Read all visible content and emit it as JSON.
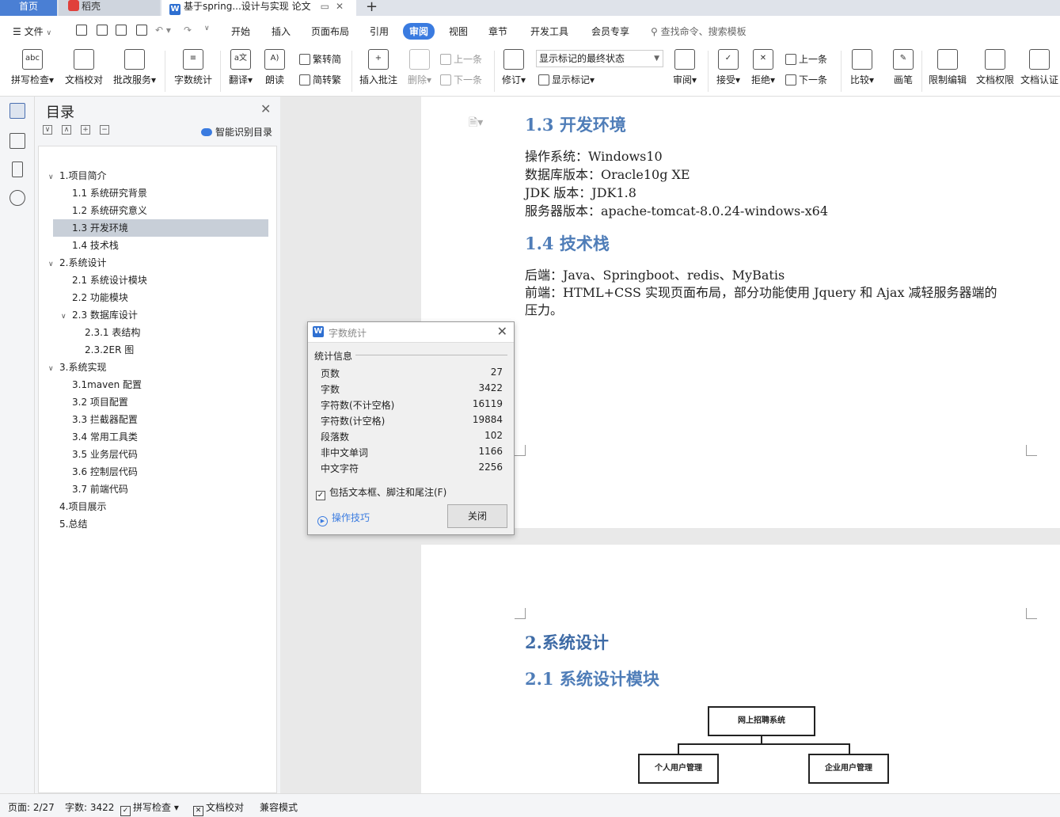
{
  "tabs": {
    "home": "首页",
    "daoke": "稻壳",
    "doc": "基于spring...设计与实现 论文"
  },
  "menu": {
    "file": "文件",
    "items": [
      "开始",
      "插入",
      "页面布局",
      "引用",
      "审阅",
      "视图",
      "章节",
      "开发工具",
      "会员专享"
    ],
    "search": "查找命令、搜索模板"
  },
  "ribbon": {
    "spell": "拼写检查",
    "doc_check": "文档校对",
    "batch": "批改服务",
    "word_count": "字数统计",
    "translate": "翻译",
    "read": "朗读",
    "trad": "繁转简",
    "simp": "简转繁",
    "insert_comment": "插入批注",
    "delete": "删除",
    "prev": "上一条",
    "next": "下一条",
    "revise": "修订",
    "markup_state": "显示标记的最终状态",
    "show_markup": "显示标记",
    "review": "审阅",
    "accept": "接受",
    "reject": "拒绝",
    "prev2": "上一条",
    "next2": "下一条",
    "compare": "比较",
    "pen": "画笔",
    "restrict": "限制编辑",
    "rights": "文档权限",
    "cert": "文档认证"
  },
  "toc": {
    "title": "目录",
    "smart": "智能识别目录",
    "items": [
      {
        "label": "1.项目简介",
        "level": 0,
        "arrow": "∨"
      },
      {
        "label": "1.1 系统研究背景",
        "level": 1
      },
      {
        "label": "1.2 系统研究意义",
        "level": 1
      },
      {
        "label": "1.3 开发环境",
        "level": 1,
        "selected": true
      },
      {
        "label": "1.4 技术栈",
        "level": 1
      },
      {
        "label": "2.系统设计",
        "level": 0,
        "arrow": "∨"
      },
      {
        "label": "2.1 系统设计模块",
        "level": 1
      },
      {
        "label": "2.2 功能模块",
        "level": 1
      },
      {
        "label": "2.3 数据库设计",
        "level": 1,
        "arrow": "∨"
      },
      {
        "label": "2.3.1 表结构",
        "level": 2
      },
      {
        "label": "2.3.2ER 图",
        "level": 2
      },
      {
        "label": "3.系统实现",
        "level": 0,
        "arrow": "∨"
      },
      {
        "label": "3.1maven 配置",
        "level": 1
      },
      {
        "label": "3.2 项目配置",
        "level": 1
      },
      {
        "label": "3.3 拦截器配置",
        "level": 1
      },
      {
        "label": "3.4 常用工具类",
        "level": 1
      },
      {
        "label": "3.5 业务层代码",
        "level": 1
      },
      {
        "label": "3.6 控制层代码",
        "level": 1
      },
      {
        "label": "3.7 前端代码",
        "level": 1
      },
      {
        "label": "4.项目展示",
        "level": 0
      },
      {
        "label": "5.总结",
        "level": 0
      }
    ]
  },
  "document": {
    "h13": "1.3 开发环境",
    "env": [
      "操作系统：Windows10",
      "数据库版本：Oracle10g XE",
      "JDK 版本：JDK1.8",
      "服务器版本：apache-tomcat-8.0.24-windows-x64"
    ],
    "h14": "1.4 技术栈",
    "stack": [
      "后端：Java、Springboot、redis、MyBatis",
      "前端：HTML+CSS 实现页面布局，部分功能使用 Jquery 和 Ajax 减轻服务器端的",
      "压力。"
    ],
    "h2": "2.系统设计",
    "h21": "2.1 系统设计模块",
    "org": {
      "root": "网上招聘系统",
      "left": "个人用户管理",
      "right": "企业用户管理"
    }
  },
  "dialog": {
    "title": "字数统计",
    "section": "统计信息",
    "stats": [
      {
        "label": "页数",
        "value": "27"
      },
      {
        "label": "字数",
        "value": "3422"
      },
      {
        "label": "字符数(不计空格)",
        "value": "16119"
      },
      {
        "label": "字符数(计空格)",
        "value": "19884"
      },
      {
        "label": "段落数",
        "value": "102"
      },
      {
        "label": "非中文单词",
        "value": "1166"
      },
      {
        "label": "中文字符",
        "value": "2256"
      }
    ],
    "checkbox": "包括文本框、脚注和尾注(F)",
    "checked": true,
    "tips": "操作技巧",
    "close": "关闭"
  },
  "status": {
    "page": "页面: 2/27",
    "words": "字数: 3422",
    "spell": "拼写检查",
    "doc_check": "文档校对",
    "compat": "兼容模式"
  },
  "colors": {
    "accent": "#3a7be0",
    "heading": "#4f7db8"
  }
}
